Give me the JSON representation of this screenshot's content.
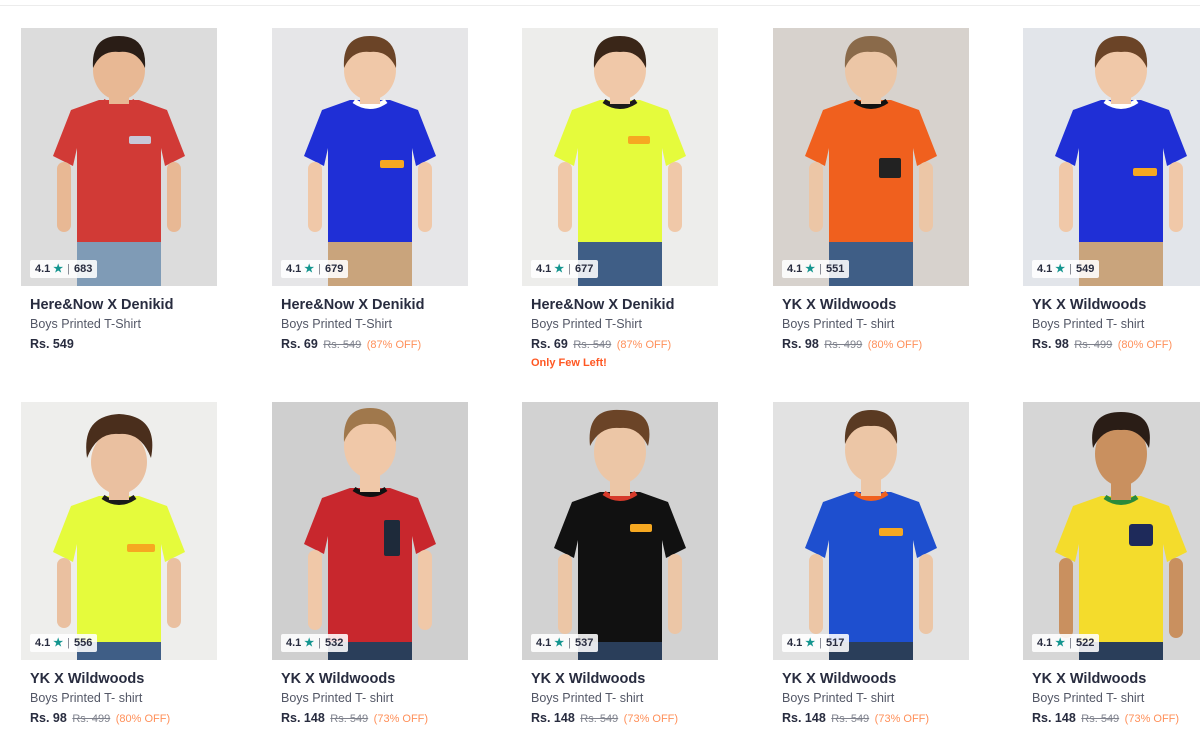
{
  "products": [
    {
      "brand": "Here&Now X Denikid",
      "desc": "Boys Printed T-Shirt",
      "price": "Rs. 549",
      "mrp": "",
      "off": "",
      "rating": "4.1",
      "count": "683",
      "note": "",
      "shirt": "#d13a36",
      "trim": "#d13a36",
      "bg": "#dcdcdc",
      "hair": "#2a1d16",
      "skin": "#e8b894",
      "pants": "#7f9bb6",
      "logo": "#c8c8d8"
    },
    {
      "brand": "Here&Now X Denikid",
      "desc": "Boys Printed T-Shirt",
      "price": "Rs. 69",
      "mrp": "Rs. 549",
      "off": "(87% OFF)",
      "rating": "4.1",
      "count": "679",
      "note": "",
      "shirt": "#1f2fd6",
      "trim": "#ffffff",
      "bg": "#e6e6e8",
      "hair": "#6b4427",
      "skin": "#f0c8a8",
      "pants": "#c9a47c",
      "logo": "#f6a821"
    },
    {
      "brand": "Here&Now X Denikid",
      "desc": "Boys Printed T-Shirt",
      "price": "Rs. 69",
      "mrp": "Rs. 549",
      "off": "(87% OFF)",
      "rating": "4.1",
      "count": "677",
      "note": "Only Few Left!",
      "shirt": "#e5fb3c",
      "trim": "#1a1a1a",
      "bg": "#ededeb",
      "hair": "#3a2618",
      "skin": "#f0c8a8",
      "pants": "#3f5e86",
      "logo": "#f6a821"
    },
    {
      "brand": "YK X Wildwoods",
      "desc": "Boys Printed T- shirt",
      "price": "Rs. 98",
      "mrp": "Rs. 499",
      "off": "(80% OFF)",
      "rating": "4.1",
      "count": "551",
      "note": "",
      "shirt": "#f0601e",
      "trim": "#111111",
      "bg": "#d7d2cd",
      "hair": "#8a6a4a",
      "skin": "#ecc6a6",
      "pants": "#3f5e86",
      "logo": "#222222"
    },
    {
      "brand": "YK X Wildwoods",
      "desc": "Boys Printed T- shirt",
      "price": "Rs. 98",
      "mrp": "Rs. 499",
      "off": "(80% OFF)",
      "rating": "4.1",
      "count": "549",
      "note": "",
      "shirt": "#1f2fd6",
      "trim": "#ffffff",
      "bg": "#e2e5ea",
      "hair": "#6b4427",
      "skin": "#f0c8a8",
      "pants": "#c9a47c",
      "logo": "#f6a821"
    },
    {
      "brand": "YK X Wildwoods",
      "desc": "Boys Printed T- shirt",
      "price": "Rs. 98",
      "mrp": "Rs. 499",
      "off": "(80% OFF)",
      "rating": "4.1",
      "count": "556",
      "note": "",
      "shirt": "#e5fb3c",
      "trim": "#1a1a1a",
      "bg": "#eeeeec",
      "hair": "#4a2e1c",
      "skin": "#eac0a0",
      "pants": "#3f5e86",
      "logo": "#f6a821"
    },
    {
      "brand": "YK X Wildwoods",
      "desc": "Boys Printed T- shirt",
      "price": "Rs. 148",
      "mrp": "Rs. 549",
      "off": "(73% OFF)",
      "rating": "4.1",
      "count": "532",
      "note": "",
      "shirt": "#c8272d",
      "trim": "#111111",
      "bg": "#cfcfcf",
      "hair": "#a0784c",
      "skin": "#f0c8a8",
      "pants": "#2a3e5a",
      "logo": "#1e2a3a"
    },
    {
      "brand": "YK X Wildwoods",
      "desc": "Boys Printed T- shirt",
      "price": "Rs. 148",
      "mrp": "Rs. 549",
      "off": "(73% OFF)",
      "rating": "4.1",
      "count": "537",
      "note": "",
      "shirt": "#111111",
      "trim": "#d63a2a",
      "bg": "#d2d2d2",
      "hair": "#6b4427",
      "skin": "#ecc6a6",
      "pants": "#2a3e5a",
      "logo": "#f6a821"
    },
    {
      "brand": "YK X Wildwoods",
      "desc": "Boys Printed T- shirt",
      "price": "Rs. 148",
      "mrp": "Rs. 549",
      "off": "(73% OFF)",
      "rating": "4.1",
      "count": "517",
      "note": "",
      "shirt": "#1e4fcf",
      "trim": "#f0601e",
      "bg": "#e2e2e2",
      "hair": "#5a3a22",
      "skin": "#ecc6a6",
      "pants": "#2a3e5a",
      "logo": "#f6a821"
    },
    {
      "brand": "YK X Wildwoods",
      "desc": "Boys Printed T- shirt",
      "price": "Rs. 148",
      "mrp": "Rs. 549",
      "off": "(73% OFF)",
      "rating": "4.1",
      "count": "522",
      "note": "",
      "shirt": "#f4dc2c",
      "trim": "#2a8a3a",
      "bg": "#d6d6d6",
      "hair": "#2a1d16",
      "skin": "#c9905f",
      "pants": "#2a3e5a",
      "logo": "#1e2a5a"
    }
  ]
}
